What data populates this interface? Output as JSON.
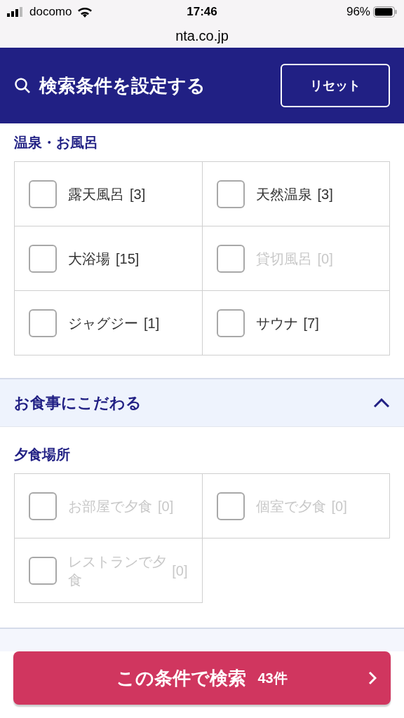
{
  "status_bar": {
    "carrier": "docomo",
    "time": "17:46",
    "battery": "96%"
  },
  "url_bar": {
    "domain": "nta.co.jp"
  },
  "header": {
    "title": "検索条件を設定する",
    "reset_button": "リセット"
  },
  "sections": [
    {
      "kind": "group",
      "title": "温泉・お風呂",
      "options": [
        {
          "label": "露天風呂",
          "count": "[3]",
          "checked": false,
          "disabled": false
        },
        {
          "label": "天然温泉",
          "count": "[3]",
          "checked": false,
          "disabled": false
        },
        {
          "label": "大浴場",
          "count": "[15]",
          "checked": false,
          "disabled": false
        },
        {
          "label": "貸切風呂",
          "count": "[0]",
          "checked": false,
          "disabled": true
        },
        {
          "label": "ジャグジー",
          "count": "[1]",
          "checked": false,
          "disabled": false
        },
        {
          "label": "サウナ",
          "count": "[7]",
          "checked": false,
          "disabled": false
        }
      ]
    },
    {
      "kind": "accordion",
      "title": "お食事にこだわる",
      "expanded": true
    },
    {
      "kind": "group",
      "title": "夕食場所",
      "options": [
        {
          "label": "お部屋で夕食",
          "count": "[0]",
          "checked": false,
          "disabled": true
        },
        {
          "label": "個室で夕食",
          "count": "[0]",
          "checked": false,
          "disabled": true
        },
        {
          "label": "レストランで夕食",
          "count": "[0]",
          "checked": false,
          "disabled": true
        }
      ]
    }
  ],
  "search_button": {
    "label": "この条件で検索",
    "count": "43件"
  }
}
